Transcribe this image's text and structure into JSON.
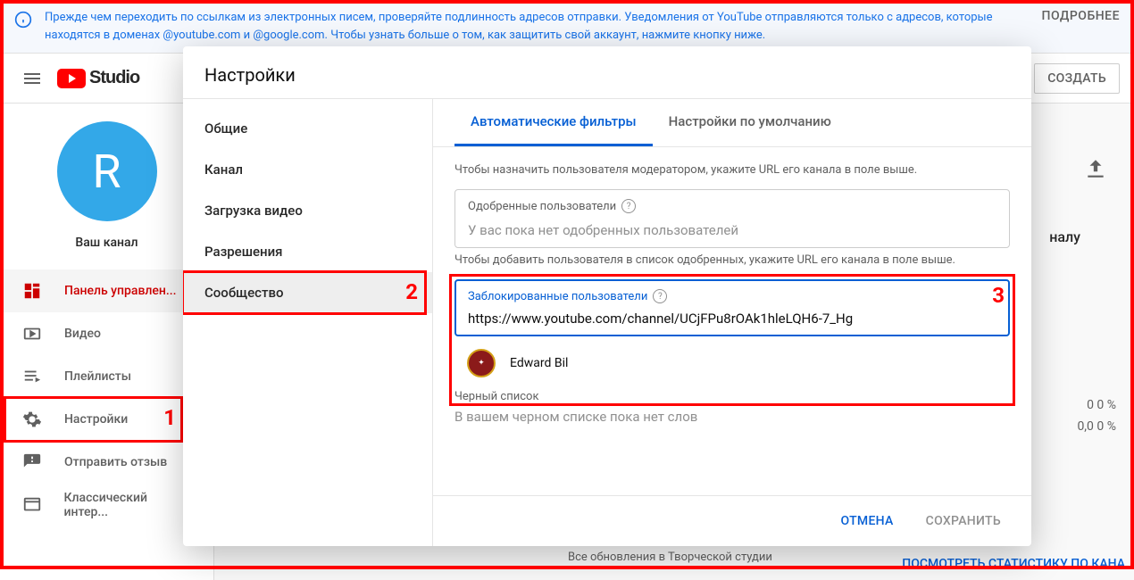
{
  "banner": {
    "text": "Прежде чем переходить по ссылкам из электронных писем, проверяйте подлинность адресов отправки. Уведомления от YouTube отправляются только с адресов, которые находятся в доменах @youtube.com и @google.com. Чтобы узнать больше о том, как защитить свой аккаунт, нажмите кнопку ниже.",
    "action": "ПОДРОБНЕЕ"
  },
  "topbar": {
    "logo_text": "Studio",
    "create": "СОЗДАТЬ"
  },
  "sidebar": {
    "avatar_letter": "R",
    "channel_label": "Ваш канал",
    "items": [
      {
        "label": "Панель управлен..."
      },
      {
        "label": "Видео"
      },
      {
        "label": "Плейлисты"
      },
      {
        "label": "Настройки"
      },
      {
        "label": "Отправить отзыв"
      },
      {
        "label": "Классический интер..."
      }
    ]
  },
  "callouts": {
    "n1": "1",
    "n2": "2",
    "n3": "3"
  },
  "background": {
    "heading_frag": "налу",
    "stat1": "0 0 %",
    "stat2": "0,0 0 %",
    "link": "ПОСМОТРЕТЬ СТАТИСТИКУ ПО КАНА",
    "bottom": "Все обновления в Творческой студии"
  },
  "modal": {
    "title": "Настройки",
    "sidebar": [
      "Общие",
      "Канал",
      "Загрузка видео",
      "Разрешения",
      "Сообщество"
    ],
    "tabs": {
      "filters": "Автоматические фильтры",
      "defaults": "Настройки по умолчанию"
    },
    "hint_moderator": "Чтобы назначить пользователя модератором, укажите URL его канала в поле выше.",
    "approved": {
      "label": "Одобренные пользователи",
      "placeholder": "У вас пока нет одобренных пользователей"
    },
    "hint_approved": "Чтобы добавить пользователя в список одобренных, укажите URL его канала в поле выше.",
    "blocked": {
      "label": "Заблокированные пользователи",
      "value": "https://www.youtube.com/channel/UCjFPu8rOAk1hleLQH6-7_Hg"
    },
    "suggestion": {
      "name": "Edward Bil"
    },
    "blacklist": {
      "label": "Черный список",
      "placeholder": "В вашем черном списке пока нет слов"
    },
    "footer": {
      "cancel": "ОТМЕНА",
      "save": "СОХРАНИТЬ"
    }
  }
}
